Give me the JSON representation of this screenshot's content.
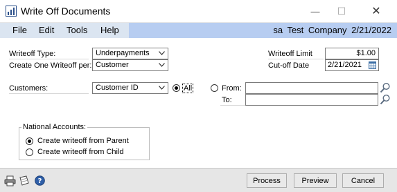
{
  "window": {
    "title": "Write Off Documents",
    "minimize_glyph": "—",
    "maximize_glyph": "☐",
    "close_glyph": "✕"
  },
  "menu": {
    "items": [
      "File",
      "Edit",
      "Tools",
      "Help"
    ],
    "user": "sa",
    "company": "Test Company",
    "date": "2/21/2022"
  },
  "form": {
    "writeoff_type_label": "Writeoff Type:",
    "writeoff_type_value": "Underpayments",
    "create_per_label": "Create One Writeoff per:",
    "create_per_value": "Customer",
    "writeoff_limit_label": "Writeoff Limit",
    "writeoff_limit_value": "$1.00",
    "cutoff_date_label": "Cut-off Date",
    "cutoff_date_value": "2/21/2021",
    "customers_label": "Customers:",
    "customers_by_value": "Customer ID",
    "all_label": "All",
    "from_label": "From:",
    "to_label": "To:",
    "from_value": "",
    "to_value": "",
    "range_selected": "All"
  },
  "national_accounts": {
    "label": "National Accounts:",
    "option_parent": "Create writeoff from Parent",
    "option_child": "Create writeoff from Child",
    "selected": "Create writeoff from Parent"
  },
  "footer": {
    "process_label": "Process",
    "preview_label": "Preview",
    "cancel_label": "Cancel"
  },
  "icons": {
    "app": "write-off-app-icon",
    "print": "printer-icon",
    "note": "note-icon",
    "help": "help-icon",
    "lookup": "magnifier-lookup-icon",
    "calendar": "calendar-icon"
  },
  "colors": {
    "menu_left_bg": "#dbe5f1",
    "menu_right_bg": "#b7cdf1",
    "bottom_bar_bg": "#e6e6e6"
  }
}
